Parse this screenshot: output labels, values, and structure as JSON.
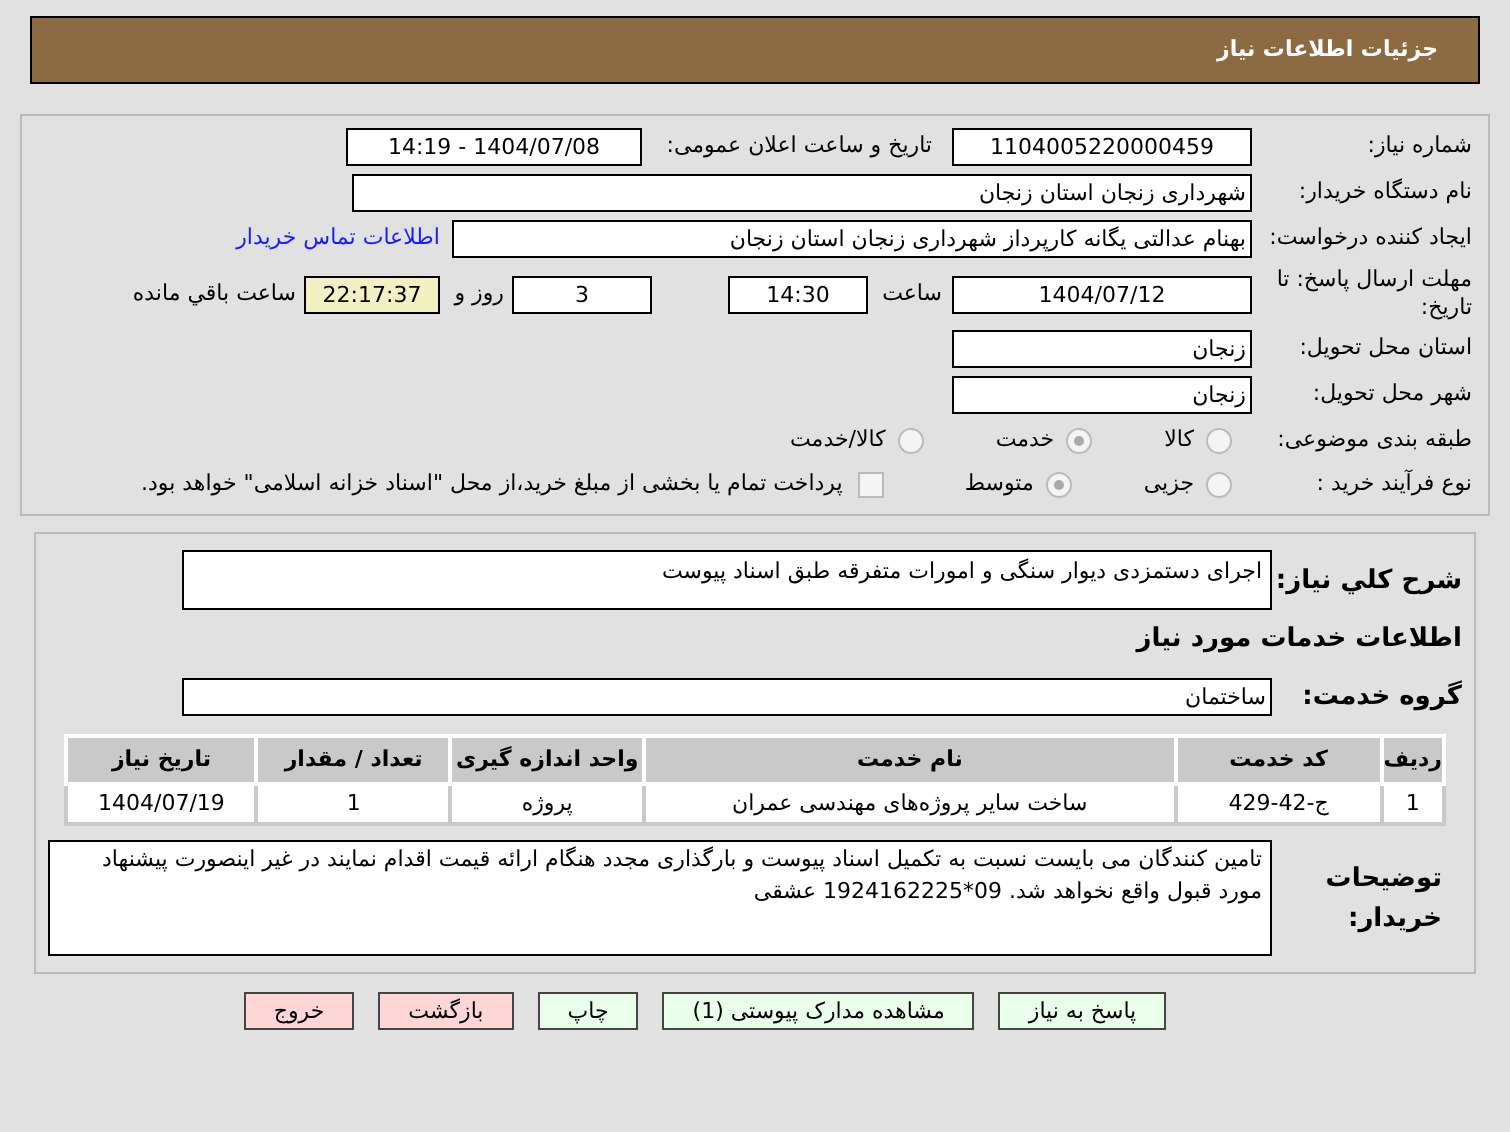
{
  "header": {
    "title": "جزئیات اطلاعات نیاز"
  },
  "details": {
    "need_number": {
      "label": "شماره نیاز:",
      "value": "1104005220000459"
    },
    "announce": {
      "label": "تاریخ و ساعت اعلان عمومی:",
      "value": "1404/07/08 - 14:19"
    },
    "buyer": {
      "label": "نام دستگاه خریدار:",
      "value": "شهرداری زنجان استان زنجان"
    },
    "creator": {
      "label": "ایجاد کننده درخواست:",
      "value": "بهنام عدالتی یگانه کارپرداز شهرداری زنجان استان زنجان",
      "link": "اطلاعات تماس خریدار"
    },
    "deadline": {
      "label": "مهلت ارسال پاسخ: تا تاریخ:",
      "date": "1404/07/12",
      "time_label": "ساعت",
      "time": "14:30",
      "days": "3",
      "days_label": "روز و",
      "remaining": "22:17:37",
      "remaining_label": "ساعت باقي مانده"
    },
    "province": {
      "label": "استان محل تحویل:",
      "value": "زنجان"
    },
    "city": {
      "label": "شهر محل تحویل:",
      "value": "زنجان"
    },
    "category": {
      "label": "طبقه بندی موضوعی:",
      "options": [
        {
          "label": "کالا",
          "selected": false
        },
        {
          "label": "خدمت",
          "selected": true
        },
        {
          "label": "کالا/خدمت",
          "selected": false
        }
      ]
    },
    "process": {
      "label": "نوع فرآیند خرید :",
      "options": [
        {
          "label": "جزیی",
          "selected": false
        },
        {
          "label": "متوسط",
          "selected": true
        }
      ],
      "treasury": {
        "label": "پرداخت تمام یا بخشی از مبلغ خرید،از محل \"اسناد خزانه اسلامی\" خواهد بود.",
        "checked": false
      }
    }
  },
  "need": {
    "description": {
      "label": "شرح کلي نیاز:",
      "value": "اجرای دستمزدی دیوار سنگی و امورات متفرقه طبق اسناد پیوست"
    },
    "services_heading": "اطلاعات خدمات مورد نیاز",
    "service_group": {
      "label": "گروه خدمت:",
      "value": "ساختمان"
    },
    "table": {
      "columns": [
        "ردیف",
        "کد خدمت",
        "نام خدمت",
        "واحد اندازه گیری",
        "تعداد / مقدار",
        "تاریخ نیاز"
      ],
      "rows": [
        [
          "1",
          "ج-42-429",
          "ساخت سایر پروژه‌های مهندسی عمران",
          "پروژه",
          "1",
          "1404/07/19"
        ]
      ]
    },
    "buyer_notes": {
      "label": "توضیحات خریدار:",
      "value": "تامین کنندگان می بایست نسبت به تکمیل اسناد پیوست و بارگذاری مجدد هنگام ارائه قیمت اقدام نمایند در غیر اینصورت پیشنهاد مورد قبول واقع نخواهد شد. 09*1924162225 عشقی"
    }
  },
  "buttons": [
    {
      "label": "پاسخ به نیاز",
      "kind": "primary"
    },
    {
      "label": "مشاهده مدارک پیوستی (1)",
      "kind": "primary"
    },
    {
      "label": "چاپ",
      "kind": "primary"
    },
    {
      "label": "بازگشت",
      "kind": "danger"
    },
    {
      "label": "خروج",
      "kind": "danger"
    }
  ]
}
